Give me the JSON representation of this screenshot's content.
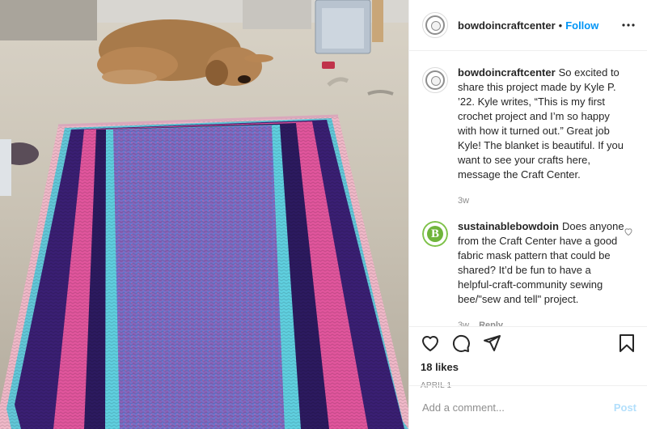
{
  "post": {
    "username": "bowdoincraftcenter",
    "separator": "•",
    "follow_label": "Follow",
    "more_icon": "more-horizontal-icon"
  },
  "caption": {
    "username": "bowdoincraftcenter",
    "text": "So excited to share this project made by Kyle P. ’22. Kyle writes, “This is my first crochet project and I’m so happy with how it turned out.” Great job Kyle! The blanket is beautiful. If you want to see your crafts here, message the Craft Center.",
    "time": "3w"
  },
  "comments": [
    {
      "username": "sustainablebowdoin",
      "avatar_letter": "B",
      "text": "Does anyone from the Craft Center have a good fabric mask pattern that could be shared? It’d be fun to have a helpful-craft-community sewing bee/\"sew and tell\" project.",
      "time": "3w",
      "reply_label": "Reply"
    }
  ],
  "actions": {
    "like_icon": "heart-icon",
    "comment_icon": "comment-icon",
    "share_icon": "paper-plane-icon",
    "save_icon": "bookmark-icon",
    "likes": "18 likes",
    "date": "APRIL 1"
  },
  "add_comment": {
    "placeholder": "Add a comment...",
    "post_label": "Post"
  },
  "colors": {
    "link_blue": "#0095f6",
    "post_disabled": "#b2dffc",
    "muted": "#8e8e8e",
    "sustainable_green": "#6fb43b"
  }
}
